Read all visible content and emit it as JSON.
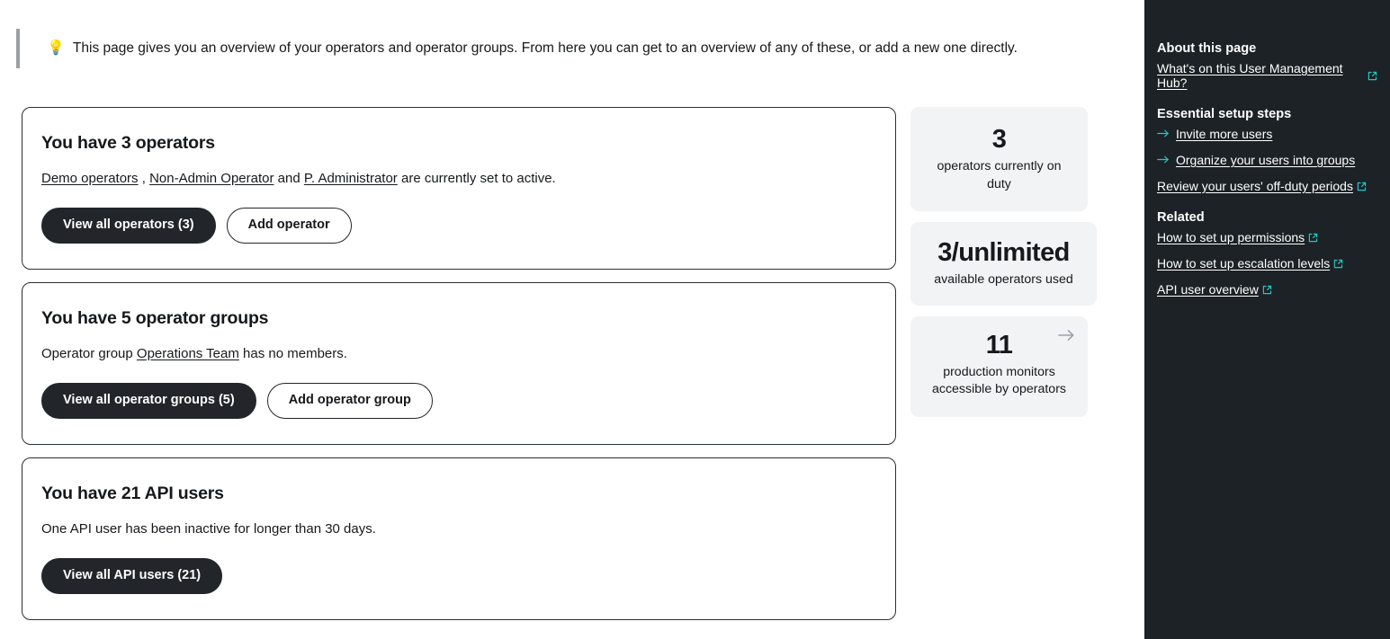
{
  "tip": {
    "icon": "lightbulb-icon",
    "text": "This page gives you an overview of your operators and operator groups. From here you can get to an overview of any of these, or add a new one directly."
  },
  "cards": [
    {
      "title": "You have 3 operators",
      "desc_links": [
        "Demo operators",
        "Non-Admin Operator",
        "P. Administrator"
      ],
      "desc_sep1": " , ",
      "desc_sep2": " and ",
      "desc_tail": " are currently set to active.",
      "primary_button": "View all operators (3)",
      "secondary_button": "Add operator"
    },
    {
      "title": "You have 5 operator groups",
      "desc_lead": "Operator group ",
      "desc_link": "Operations Team",
      "desc_tail": " has no members.",
      "primary_button": "View all operator groups (5)",
      "secondary_button": "Add operator group"
    },
    {
      "title": "You have 21 API users",
      "desc": "One API user has been inactive for longer than 30 days.",
      "primary_button": "View all API users (21)"
    }
  ],
  "stats": [
    {
      "value": "3",
      "label": "operators currently on duty"
    },
    {
      "value": "3/unlimited",
      "label": "available operators used"
    },
    {
      "value": "11",
      "label": "production monitors accessible by operators",
      "arrow_icon": "arrow-right-icon"
    }
  ],
  "sidebar": {
    "about": {
      "heading": "About this page",
      "links": [
        {
          "label": "What's on this User Management Hub?",
          "external": true,
          "arrow": false
        }
      ]
    },
    "setup": {
      "heading": "Essential setup steps",
      "links": [
        {
          "label": "Invite more users",
          "external": false,
          "arrow": true
        },
        {
          "label": "Organize your users into groups",
          "external": false,
          "arrow": true
        },
        {
          "label": "Review your users' off-duty periods",
          "external": true,
          "arrow": false
        }
      ]
    },
    "related": {
      "heading": "Related",
      "links": [
        {
          "label": "How to set up permissions",
          "external": true,
          "arrow": false
        },
        {
          "label": "How to set up escalation levels",
          "external": true,
          "arrow": false
        },
        {
          "label": "API user overview",
          "external": true,
          "arrow": false
        }
      ]
    }
  },
  "colors": {
    "sidebar_bg": "#1c2225",
    "accent_teal": "#22c7c7",
    "primary_button_bg": "#22262a",
    "stat_card_bg": "#f2f3f4",
    "tip_border": "#9aa0a6"
  }
}
